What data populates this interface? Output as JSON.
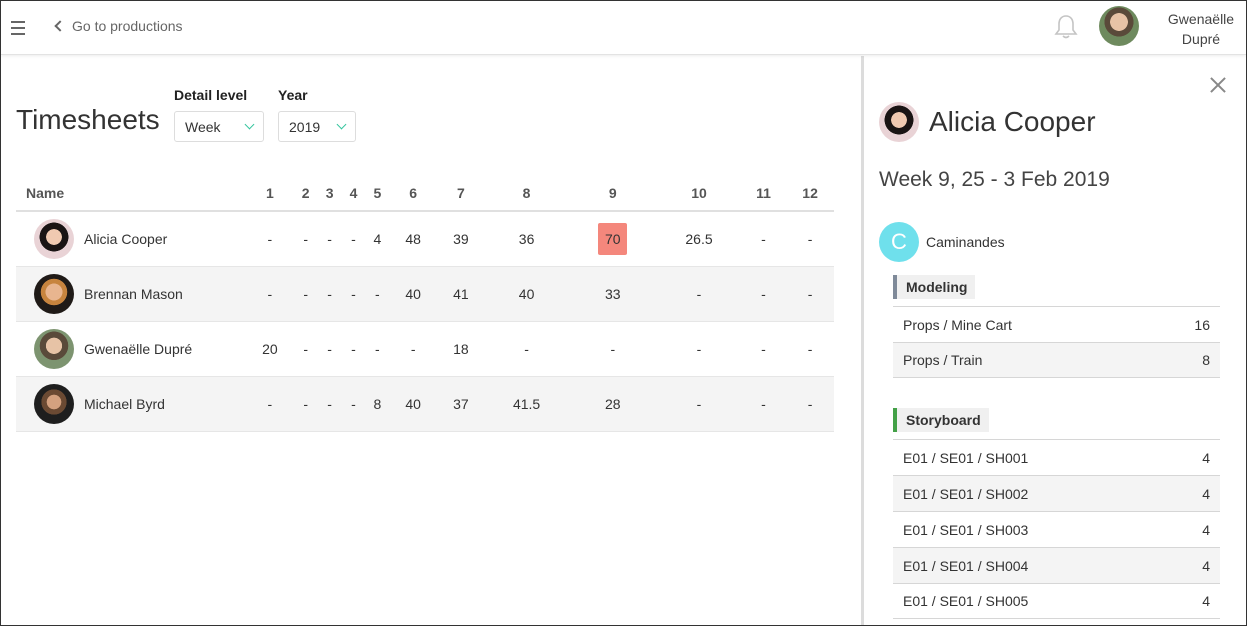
{
  "topbar": {
    "back_label": "Go to productions",
    "user_name_line1": "Gwenaëlle",
    "user_name_line2": "Dupré"
  },
  "page": {
    "title": "Timesheets",
    "detail_level_label": "Detail level",
    "detail_level_value": "Week",
    "year_label": "Year",
    "year_value": "2019"
  },
  "table": {
    "name_header": "Name",
    "week_headers": [
      "1",
      "2",
      "3",
      "4",
      "5",
      "6",
      "7",
      "8",
      "9",
      "10",
      "11",
      "12"
    ],
    "rows": [
      {
        "name": "Alicia Cooper",
        "cells": [
          "-",
          "-",
          "-",
          "-",
          "4",
          "48",
          "39",
          "36",
          "70",
          "26.5",
          "-",
          "-"
        ]
      },
      {
        "name": "Brennan Mason",
        "cells": [
          "-",
          "-",
          "-",
          "-",
          "-",
          "40",
          "41",
          "40",
          "33",
          "-",
          "-",
          "-"
        ]
      },
      {
        "name": "Gwenaëlle Dupré",
        "cells": [
          "20",
          "-",
          "-",
          "-",
          "-",
          "-",
          "18",
          "-",
          "-",
          "-",
          "-",
          "-"
        ]
      },
      {
        "name": "Michael Byrd",
        "cells": [
          "-",
          "-",
          "-",
          "-",
          "8",
          "40",
          "37",
          "41.5",
          "28",
          "-",
          "-",
          "-"
        ]
      }
    ],
    "overtime_color": "#e8484b",
    "selected_color": "#f4877c"
  },
  "panel": {
    "person_name": "Alicia Cooper",
    "week_title": "Week 9, 25 - 3 Feb 2019",
    "production_initial": "C",
    "production_name": "Caminandes",
    "production_color": "#6fe0ec",
    "sections": [
      {
        "name": "Modeling",
        "color": "#7f8a99",
        "tasks": [
          {
            "entity": "Props / Mine Cart",
            "hours": "16"
          },
          {
            "entity": "Props / Train",
            "hours": "8"
          }
        ]
      },
      {
        "name": "Storyboard",
        "color": "#43a047",
        "tasks": [
          {
            "entity": "E01 / SE01 / SH001",
            "hours": "4"
          },
          {
            "entity": "E01 / SE01 / SH002",
            "hours": "4"
          },
          {
            "entity": "E01 / SE01 / SH003",
            "hours": "4"
          },
          {
            "entity": "E01 / SE01 / SH004",
            "hours": "4"
          },
          {
            "entity": "E01 / SE01 / SH005",
            "hours": "4"
          }
        ]
      }
    ]
  }
}
